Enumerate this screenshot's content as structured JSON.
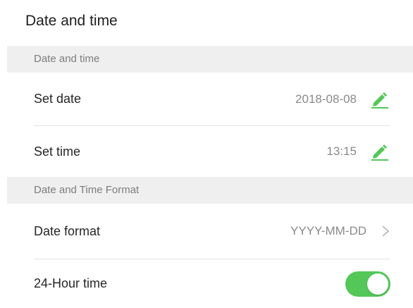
{
  "page": {
    "title": "Date and time"
  },
  "sections": [
    {
      "header": "Date and time",
      "rows": [
        {
          "label": "Set date",
          "value": "2018-08-08",
          "action_icon": "edit-icon"
        },
        {
          "label": "Set time",
          "value": "13:15",
          "action_icon": "edit-icon"
        }
      ]
    },
    {
      "header": "Date and Time Format",
      "rows": [
        {
          "label": "Date format",
          "value": "YYYY-MM-DD",
          "action_icon": "chevron-right-icon"
        },
        {
          "label": "24-Hour time",
          "toggle_on": true
        }
      ]
    }
  ],
  "colors": {
    "accent": "#53c758",
    "section_bg": "#efefef",
    "value_text": "#8a8a8a"
  }
}
